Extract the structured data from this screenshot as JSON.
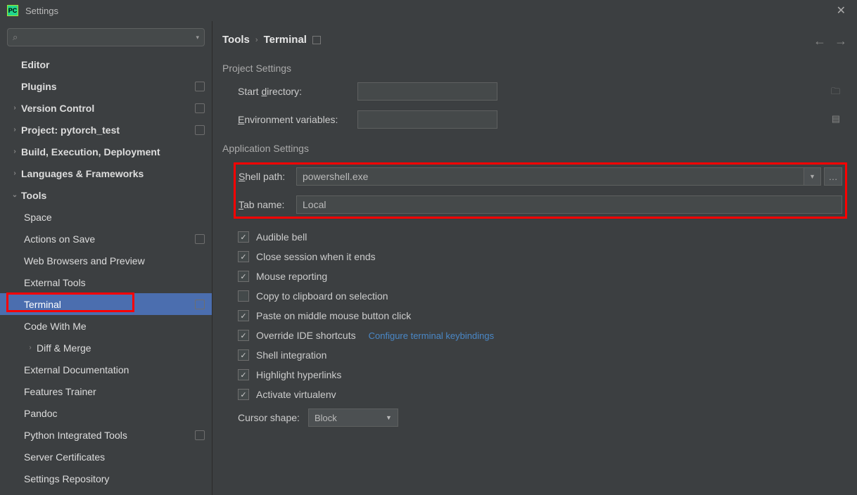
{
  "window": {
    "title": "Settings"
  },
  "sidebar": {
    "items": [
      {
        "label": "Editor",
        "level": 1,
        "bold": true,
        "chev": null,
        "badge": false
      },
      {
        "label": "Plugins",
        "level": 1,
        "bold": true,
        "chev": null,
        "badge": true
      },
      {
        "label": "Version Control",
        "level": 1,
        "bold": true,
        "chev": "right",
        "badge": true
      },
      {
        "label": "Project: pytorch_test",
        "level": 1,
        "bold": true,
        "chev": "right",
        "badge": true
      },
      {
        "label": "Build, Execution, Deployment",
        "level": 1,
        "bold": true,
        "chev": "right",
        "badge": false
      },
      {
        "label": "Languages & Frameworks",
        "level": 1,
        "bold": true,
        "chev": "right",
        "badge": false
      },
      {
        "label": "Tools",
        "level": 1,
        "bold": true,
        "chev": "down",
        "badge": false
      },
      {
        "label": "Space",
        "level": 2,
        "badge": false
      },
      {
        "label": "Actions on Save",
        "level": 2,
        "badge": true
      },
      {
        "label": "Web Browsers and Preview",
        "level": 2,
        "badge": false
      },
      {
        "label": "External Tools",
        "level": 2,
        "badge": false
      },
      {
        "label": "Terminal",
        "level": 2,
        "badge": true,
        "selected": true
      },
      {
        "label": "Code With Me",
        "level": 2,
        "badge": false
      },
      {
        "label": "Diff & Merge",
        "level": 2,
        "chev": "right",
        "badge": false
      },
      {
        "label": "External Documentation",
        "level": 2,
        "badge": false
      },
      {
        "label": "Features Trainer",
        "level": 2,
        "badge": false
      },
      {
        "label": "Pandoc",
        "level": 2,
        "badge": false
      },
      {
        "label": "Python Integrated Tools",
        "level": 2,
        "badge": true
      },
      {
        "label": "Server Certificates",
        "level": 2,
        "badge": false
      },
      {
        "label": "Settings Repository",
        "level": 2,
        "badge": false
      }
    ]
  },
  "breadcrumb": {
    "root": "Tools",
    "current": "Terminal"
  },
  "sections": {
    "project": {
      "title": "Project Settings",
      "start_dir_label": "Start directory:",
      "start_dir_value": "",
      "env_label": "Environment variables:",
      "env_value": ""
    },
    "app": {
      "title": "Application Settings",
      "shell_label": "Shell path:",
      "shell_value": "powershell.exe",
      "tab_label": "Tab name:",
      "tab_value": "Local",
      "checkboxes": [
        {
          "label": "Audible bell",
          "checked": true
        },
        {
          "label": "Close session when it ends",
          "checked": true
        },
        {
          "label": "Mouse reporting",
          "checked": true
        },
        {
          "label": "Copy to clipboard on selection",
          "checked": false
        },
        {
          "label": "Paste on middle mouse button click",
          "checked": true
        },
        {
          "label": "Override IDE shortcuts",
          "checked": true,
          "link": "Configure terminal keybindings"
        },
        {
          "label": "Shell integration",
          "checked": true
        },
        {
          "label": "Highlight hyperlinks",
          "checked": true
        },
        {
          "label": "Activate virtualenv",
          "checked": true
        }
      ],
      "cursor_label": "Cursor shape:",
      "cursor_value": "Block"
    }
  }
}
